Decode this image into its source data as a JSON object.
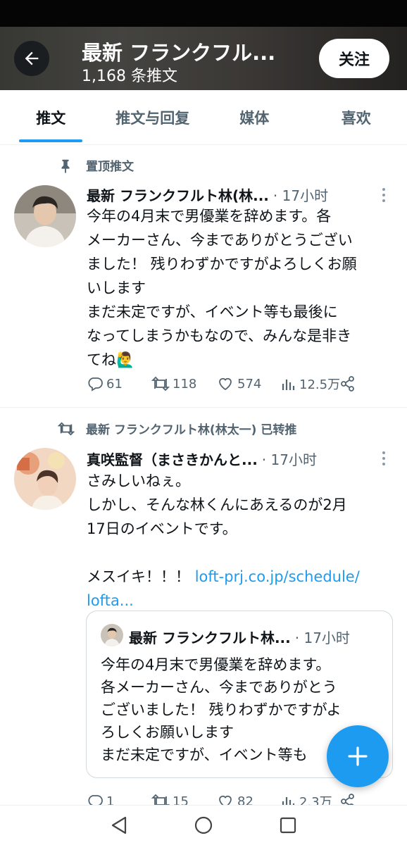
{
  "header": {
    "title": "最新 フランクフル...",
    "tweet_count": "1,168 条推文",
    "follow_label": "关注"
  },
  "tabs": [
    {
      "label": "推文",
      "active": true
    },
    {
      "label": "推文与回复",
      "active": false
    },
    {
      "label": "媒体",
      "active": false
    },
    {
      "label": "喜欢",
      "active": false
    }
  ],
  "tweets": [
    {
      "context": "置顶推文",
      "context_icon": "pin-icon",
      "author": "最新 フランクフルト林(林...",
      "time": "· 17小时",
      "text": "今年の4月末で男優業を辞めます。各\nメーカーさん、今までありがとうござい\nました！ 残りわずかですがよろしくお願\nいします\nまだ未定ですが、イベント等も最後に\nなってしまうかもなので、みんな是非き\nてね🙋‍♂️",
      "replies": "61",
      "retweets": "118",
      "likes": "574",
      "views": "12.5万"
    },
    {
      "context": "最新 フランクフルト林(林太一) 已转推",
      "context_icon": "retweet-icon",
      "author": "真咲監督（まさきかんと...",
      "time": "· 17小时",
      "text": "さみしいねぇ。\nしかし、そんな林くんにあえるのが2月\n17日のイベントです。\n\nメスイキ！！！ ",
      "link": "loft-prj.co.jp/schedule/\nlofta...",
      "quote": {
        "author": "最新 フランクフルト林...",
        "time": "· 17小时",
        "text": "今年の4月末で男優業を辞めます。\n各メーカーさん、今までありがとう\nございました！ 残りわずかですがよ\nろしくお願いします\nまだ未定ですが、イベント等も"
      },
      "replies": "1",
      "retweets": "15",
      "likes": "82",
      "views": "2.3万"
    }
  ],
  "colors": {
    "accent": "#1d9bf0",
    "text": "#0f1419",
    "secondary": "#536471"
  }
}
